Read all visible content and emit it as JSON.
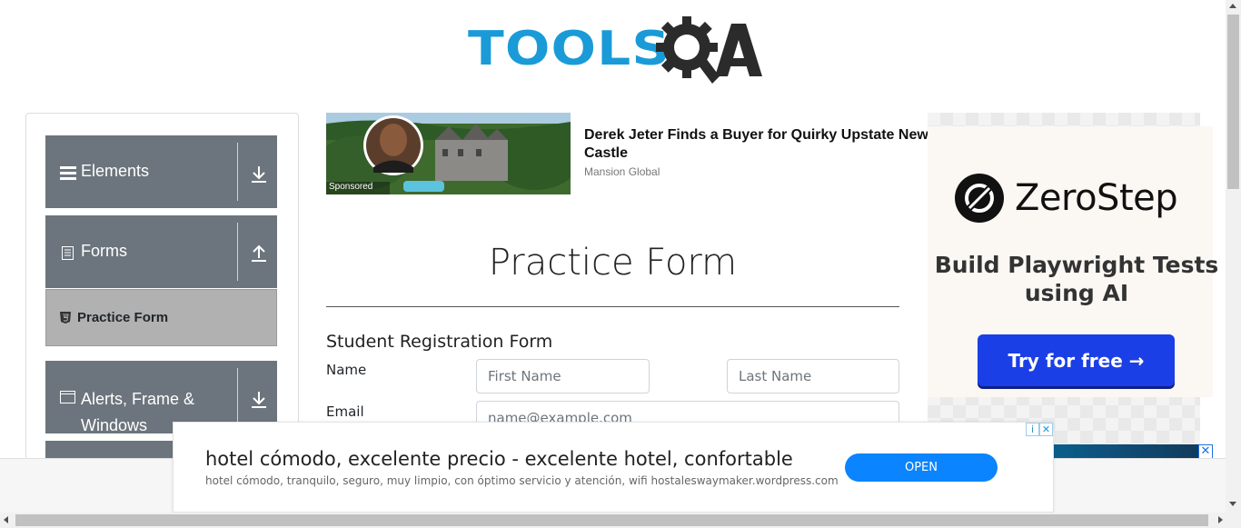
{
  "header": {
    "logo_text": "TOOLS",
    "logo_suffix": "A"
  },
  "sidebar": {
    "groups": [
      {
        "label": "Elements",
        "icon": "hamburger-icon",
        "arrow": "download-arrow-icon"
      },
      {
        "label": "Forms",
        "icon": "document-icon",
        "arrow": "upload-arrow-icon"
      },
      {
        "label": "Alerts, Frame & Windows",
        "icon": "window-icon",
        "arrow": "download-arrow-icon"
      }
    ],
    "active_item": {
      "label": "Practice Form",
      "icon": "html5-icon"
    }
  },
  "sponsored": {
    "badge": "Sponsored",
    "title": "Derek Jeter Finds a Buyer for Quirky Upstate New Castle",
    "source": "Mansion Global"
  },
  "form": {
    "page_title": "Practice Form",
    "heading": "Student Registration Form",
    "name_label": "Name",
    "first_name_placeholder": "First Name",
    "last_name_placeholder": "Last Name",
    "email_label": "Email",
    "email_placeholder": "name@example.com"
  },
  "right_ad": {
    "brand": "ZeroStep",
    "headline": "Build Playwright Tests using AI",
    "cta": "Try for free →",
    "close_icon": "close-icon"
  },
  "bottom_ad": {
    "headline": "hotel cómodo, excelente precio - excelente hotel, confortable",
    "description": "hotel cómodo, tranquilo, seguro, muy limpio, con óptimo servicio y atención, wifi hostaleswaymaker.wordpress.com",
    "button": "OPEN",
    "adchoices_i": "i",
    "adchoices_x": "✕"
  },
  "colors": {
    "brand_blue": "#1a9bd7",
    "sidebar_header": "#6c757d",
    "active_item_bg": "#b1b1b1",
    "zerostep_button": "#1b3fe6",
    "open_button": "#0a84ff"
  }
}
